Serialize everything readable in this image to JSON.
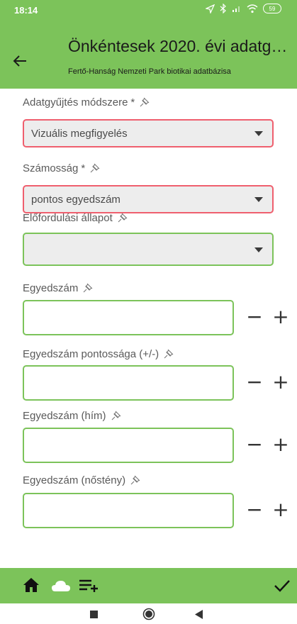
{
  "status": {
    "time": "18:14",
    "battery": "59"
  },
  "appbar": {
    "title": "Önkéntesek 2020. évi adatgy…",
    "subtitle": "Fertő-Hanság Nemzeti Park biotikai adatbázisa"
  },
  "form": {
    "method": {
      "label": "Adatgyűjtés módszere",
      "required_mark": "*",
      "value": "Vizuális megfigyelés"
    },
    "abundance": {
      "label": "Számosság",
      "required_mark": "*",
      "value": "pontos egyedszám"
    },
    "occurrence": {
      "label": "Előfordulási állapot",
      "value": ""
    },
    "count": {
      "label": "Egyedszám",
      "value": ""
    },
    "count_precision": {
      "label": "Egyedszám pontossága (+/-)",
      "value": ""
    },
    "count_male": {
      "label": "Egyedszám (hím)",
      "value": ""
    },
    "count_female": {
      "label": "Egyedszám (nőstény)",
      "value": ""
    }
  },
  "stepper": {
    "minus": "−",
    "plus": "+"
  },
  "colors": {
    "accent": "#7cc35a",
    "error": "#ef5f6e",
    "field_bg": "#ededed"
  },
  "icons": [
    "back-arrow-icon",
    "pin-icon",
    "home-icon",
    "cloud-icon",
    "playlist-add-icon",
    "check-icon",
    "stop-icon",
    "circle-home-icon",
    "back-triangle-icon"
  ]
}
